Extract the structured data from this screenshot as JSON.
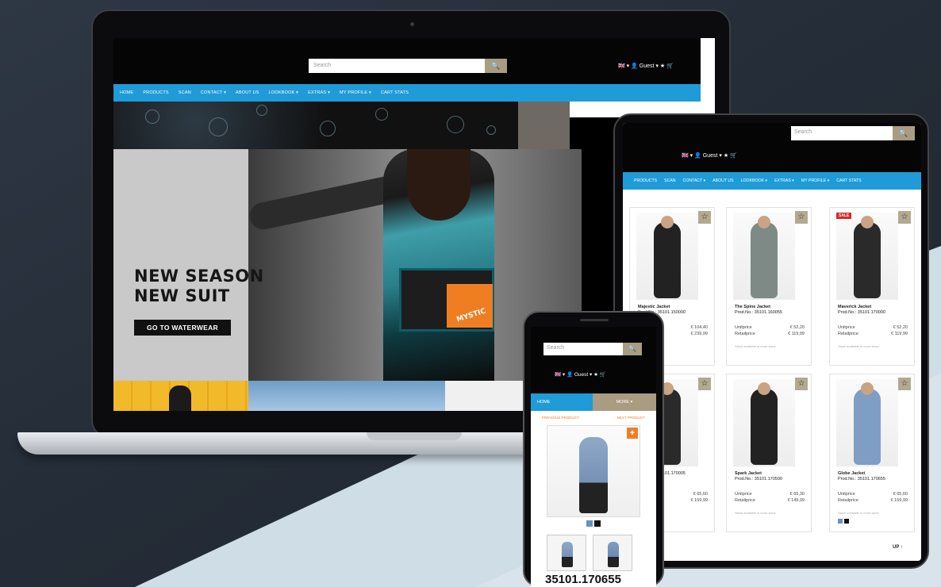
{
  "laptop": {
    "search_placeholder": "Search",
    "search_button": "🔍",
    "user_menu": "🇬🇧 ▾  👤 Guest ▾  ★  🛒",
    "nav": [
      "HOME",
      "PRODUCTS",
      "SCAN",
      "CONTACT ▾",
      "ABOUT US",
      "LOOKBOOK ▾",
      "EXTRAS ▾",
      "MY PROFILE ▾",
      "CART STATS"
    ],
    "hero": {
      "title_line1": "NEW SEASON",
      "title_line2": "NEW SUIT",
      "cta": "GO TO WATERWEAR",
      "brand": "MYSTIC"
    }
  },
  "tablet": {
    "search_placeholder": "Search",
    "search_button": "🔍",
    "user_menu": "🇬🇧 ▾  👤 Guest ▾  ★  🛒",
    "nav": [
      "PRODUCTS",
      "SCAN",
      "CONTACT ▾",
      "ABOUT US",
      "LOOKBOOK ▾",
      "EXTRAS ▾",
      "MY PROFILE ▾",
      "CART STATS"
    ],
    "products": [
      {
        "name": "Majestic Jacket",
        "prodno": "Prod.No.: 35101.150000",
        "unit_label": "Unitprice",
        "unit": "€ 104,40",
        "retail_label": "Retailprice",
        "retail": "€ 239,99",
        "stock": "",
        "sale": "",
        "color": "#222222"
      },
      {
        "name": "The Spine Jacket",
        "prodno": "Prod.No.: 35101.160055",
        "unit_label": "Unitprice",
        "unit": "€ 52,20",
        "retail_label": "Retailprice",
        "retail": "€ 119,99",
        "stock": "Stock available in more sizes",
        "sale": "",
        "color": "#7d8a86"
      },
      {
        "name": "Maverick Jacket",
        "prodno": "Prod.No.: 35101.170000",
        "unit_label": "Unitprice",
        "unit": "€ 52,20",
        "retail_label": "Retailprice",
        "retail": "€ 119,99",
        "stock": "Stock available in more sizes",
        "sale": "SALE",
        "color": "#2a2a2a"
      },
      {
        "name": "",
        "prodno": "Prod.No.: 35101.170005",
        "unit_label": "",
        "unit": "€ 65,60",
        "retail_label": "",
        "retail": "€ 159,99",
        "stock": "",
        "sale": "",
        "color": "#2a2a2a"
      },
      {
        "name": "Spark Jacket",
        "prodno": "Prod.No.: 35101.170500",
        "unit_label": "Unitprice",
        "unit": "€ 65,30",
        "retail_label": "Retailprice",
        "retail": "€ 149,99",
        "stock": "Stock available in more sizes",
        "sale": "",
        "color": "#222222"
      },
      {
        "name": "Globe Jacket",
        "prodno": "Prod.No.: 35101.170655",
        "unit_label": "Unitprice",
        "unit": "€ 65,60",
        "retail_label": "Retailprice",
        "retail": "€ 159,99",
        "stock": "Stock available in more sizes",
        "sale": "",
        "color": "#7f9ec4"
      }
    ],
    "up_label": "UP ↑"
  },
  "phone": {
    "search_placeholder": "Search",
    "search_button": "🔍",
    "user_menu": "🇬🇧 ▾  👤 Guest ▾  ★  🛒",
    "home_tab": "HOME",
    "more_tab": "MORE ▾",
    "prev_label": "PREVIOUS PRODUCT",
    "next_label": "NEXT PRODUCT",
    "product_code": "35101.170655"
  },
  "colors": {
    "nav_blue": "#1f9bd8",
    "accent_tan": "#a89c82",
    "accent_orange": "#ef7d22",
    "sale_red": "#d62828"
  }
}
